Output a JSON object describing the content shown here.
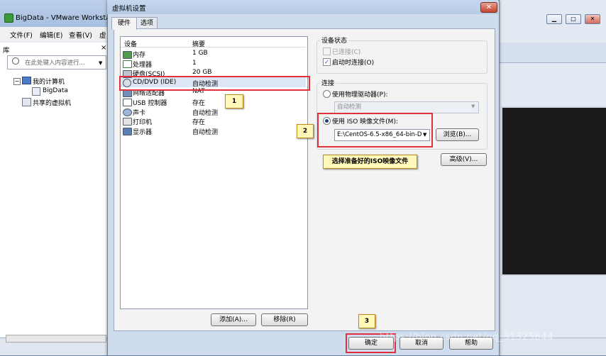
{
  "vmware": {
    "title": "BigData - VMware Workstatio",
    "menu": [
      "文件(F)",
      "编辑(E)",
      "查看(V)",
      "虚"
    ],
    "library": {
      "header": "库",
      "close": "×",
      "search_placeholder": "在此处键入内容进行...",
      "tree": [
        {
          "label": "我的计算机"
        },
        {
          "label": "BigData"
        },
        {
          "label": "共享的虚拟机"
        }
      ]
    },
    "window_buttons": [
      "▁",
      "□",
      "✕"
    ]
  },
  "dialog": {
    "title": "虚拟机设置",
    "close": "✕",
    "tabs": [
      "硬件",
      "选项"
    ],
    "device_table": {
      "col_device": "设备",
      "col_summary": "摘要",
      "rows": [
        {
          "name": "内存",
          "summary": "1 GB",
          "icon": "memory-icon"
        },
        {
          "name": "处理器",
          "summary": "1",
          "icon": "cpu-icon"
        },
        {
          "name": "硬盘(SCSI)",
          "summary": "20 GB",
          "icon": "harddisk-icon"
        },
        {
          "name": "CD/DVD (IDE)",
          "summary": "自动检测",
          "icon": "cd-dvd-icon"
        },
        {
          "name": "网络适配器",
          "summary": "NAT",
          "icon": "network-adapter-icon"
        },
        {
          "name": "USB 控制器",
          "summary": "存在",
          "icon": "usb-icon"
        },
        {
          "name": "声卡",
          "summary": "自动检测",
          "icon": "sound-card-icon"
        },
        {
          "name": "打印机",
          "summary": "存在",
          "icon": "printer-icon"
        },
        {
          "name": "显示器",
          "summary": "自动检测",
          "icon": "display-icon"
        }
      ]
    },
    "add_button": "添加(A)...",
    "remove_button": "移除(R)",
    "device_status": {
      "label": "设备状态",
      "connected": "已连接(C)",
      "connect_on_start": "启动时连接(O)"
    },
    "connection": {
      "label": "连接",
      "physical_drive": "使用物理驱动器(P):",
      "physical_drive_value": "自动检测",
      "iso_file": "使用 ISO 映像文件(M):",
      "iso_path": "E:\\CentOS-6.5-x86_64-bin-D",
      "browse_button": "浏览(B)..."
    },
    "advanced_button": "高级(V)...",
    "ok_button": "确定",
    "cancel_button": "取消",
    "help_button": "帮助"
  },
  "annotations": {
    "callout_1": "1",
    "callout_2": "2",
    "callout_3": "3",
    "iso_note": "选择准备好的ISO映像文件"
  },
  "watermark": "https://blog.csdn.net/qq_31325644"
}
